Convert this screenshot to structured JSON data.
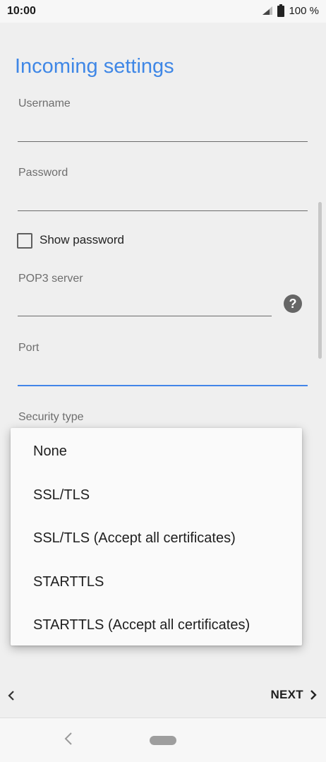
{
  "status_bar": {
    "time": "10:00",
    "battery": "100 %"
  },
  "page": {
    "title": "Incoming settings"
  },
  "fields": {
    "username": {
      "label": "Username",
      "value": ""
    },
    "password": {
      "label": "Password",
      "value": ""
    },
    "show_password": {
      "label": "Show password",
      "checked": false
    },
    "pop3_server": {
      "label": "POP3 server",
      "value": ""
    },
    "port": {
      "label": "Port",
      "value": ""
    },
    "security_type": {
      "label": "Security type"
    }
  },
  "security_menu": {
    "options": [
      "None",
      "SSL/TLS",
      "SSL/TLS (Accept all certificates)",
      "STARTTLS",
      "STARTTLS (Accept all certificates)"
    ]
  },
  "bottom": {
    "next_label": "NEXT"
  },
  "icons": {
    "signal": "signal-icon",
    "battery": "battery-icon",
    "help": "help-icon",
    "back": "chevron-left-icon",
    "next": "chevron-right-icon",
    "nav_back": "nav-back-icon",
    "nav_home": "nav-home-icon"
  },
  "colors": {
    "accent": "#3f87e6",
    "background": "#efefef"
  }
}
